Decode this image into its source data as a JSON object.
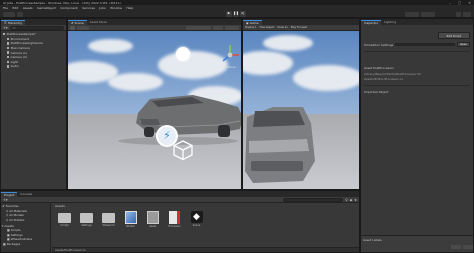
{
  "window": {
    "title": "AI Jobs - PostProcessSample - Windows, Mac, Linux - Unity 2022.3.0f1 <DX11>"
  },
  "menu": [
    "File",
    "Edit",
    "Assets",
    "GameObject",
    "Component",
    "Services",
    "Jobs",
    "Window",
    "Help"
  ],
  "hierarchy": {
    "tab": "Hierarchy",
    "search_placeholder": "All",
    "items": [
      {
        "label": "PostProcessSample*",
        "level": 0
      },
      {
        "label": "Environment",
        "level": 1
      },
      {
        "label": "PostProcessingVolume",
        "level": 1
      },
      {
        "label": "Main Camera",
        "level": 1
      },
      {
        "label": "Camera (1)",
        "level": 1
      },
      {
        "label": "Camera (2)",
        "level": 1
      },
      {
        "label": "Light",
        "level": 1
      },
      {
        "label": "Audio",
        "level": 1
      }
    ]
  },
  "scene": {
    "tab": "Scene",
    "tab2": "Asset Store",
    "gizmo_label": "< Persp"
  },
  "game": {
    "tab": "Game",
    "display": "Display 1",
    "aspect": "Free Aspect",
    "scale": "Scale 1x",
    "play_focused": "Play Focused"
  },
  "inspector": {
    "tabs": [
      "Inspector",
      "Lighting"
    ],
    "buttons": [
      "Edit Script",
      "Open"
    ],
    "header_label": "Simulation Settings",
    "section": "Asset PostProcessor",
    "value1": "Library/Bee/Artifacts/PostProcessor.dll",
    "value2": "Assets/Editor/Processor.cs",
    "label3": "Imported Object",
    "asset_labels": "Asset Labels"
  },
  "project": {
    "tabs": [
      "Project",
      "Console"
    ],
    "favorites": "Favorites",
    "fav_items": [
      "All Materials",
      "All Models",
      "All Prefabs"
    ],
    "assets_root": "Assets",
    "asset_tree": [
      "Scripts",
      "Settings",
      "WheelColliders",
      "Packages"
    ],
    "breadcrumb": "Assets",
    "files": [
      {
        "label": "Scripts",
        "kind": "folder"
      },
      {
        "label": "Settings",
        "kind": "folder"
      },
      {
        "label": "Wheelcoll",
        "kind": "folder"
      },
      {
        "label": "Shader",
        "kind": "shader"
      },
      {
        "label": "Asset",
        "kind": "asset"
      },
      {
        "label": "Processor",
        "kind": "script-red"
      },
      {
        "label": "Scene",
        "kind": "unity"
      }
    ],
    "footer": "Assets/PostProcessor.cs"
  },
  "colors": {
    "accent": "#3c8ddc",
    "panel": "#383838",
    "bg": "#191919"
  }
}
